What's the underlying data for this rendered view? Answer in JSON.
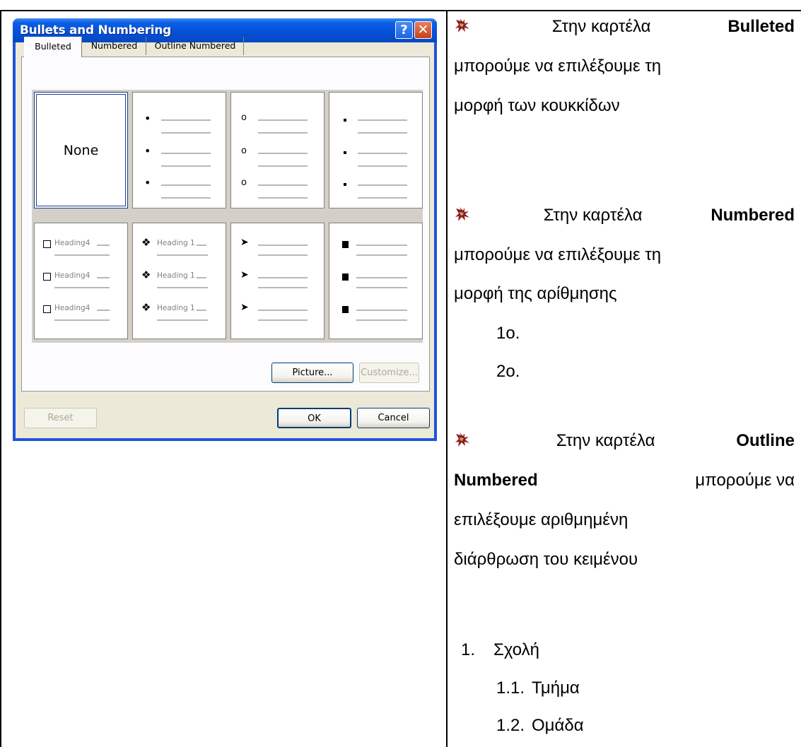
{
  "dialog": {
    "title": "Bullets and Numbering",
    "help_glyph": "?",
    "close_glyph": "✕",
    "tabs": [
      {
        "label": "Bulleted",
        "selected": true
      },
      {
        "label": "Numbered",
        "selected": false
      },
      {
        "label": "Outline Numbered",
        "selected": false
      }
    ],
    "none_label": "None",
    "heading4": "Heading4",
    "heading1": "Heading 1",
    "buttons": {
      "picture": "Picture...",
      "customize": "Customize...",
      "reset": "Reset",
      "ok": "OK",
      "cancel": "Cancel"
    },
    "colors": {
      "titlebar": "#0551d8",
      "face": "#ece9d8",
      "selected_border": "#1d3d8f"
    }
  },
  "text": {
    "p1_a": "Στην καρτέλα",
    "p1_b": "Bulleted",
    "p1_c": "μπορούμε να επιλέξουμε τη",
    "p1_d": "μορφή των κουκκίδων",
    "p2_a": "Στην καρτέλα",
    "p2_b": "Numbered",
    "p2_c": "μπορούμε να επιλέξουμε τη",
    "p2_d": "μορφή της αρίθμησης",
    "n1": "1ο.",
    "n2": "2ο.",
    "p3_a": "Στην καρτέλα",
    "p3_b": "Outline",
    "p3_c": "Numbered",
    "p3_d": "μπορούμε να",
    "p3_e": "επιλέξουμε αριθμημένη",
    "p3_f": "διάρθρωση του κειμένου",
    "list": [
      {
        "num": "1.",
        "label": "Σχολή"
      },
      {
        "num": "1.1.",
        "label": "Τμήμα"
      },
      {
        "num": "1.2.",
        "label": "Ομάδα"
      }
    ]
  },
  "icons": {
    "paragraph_bullet": "ornament-bullet-icon"
  }
}
